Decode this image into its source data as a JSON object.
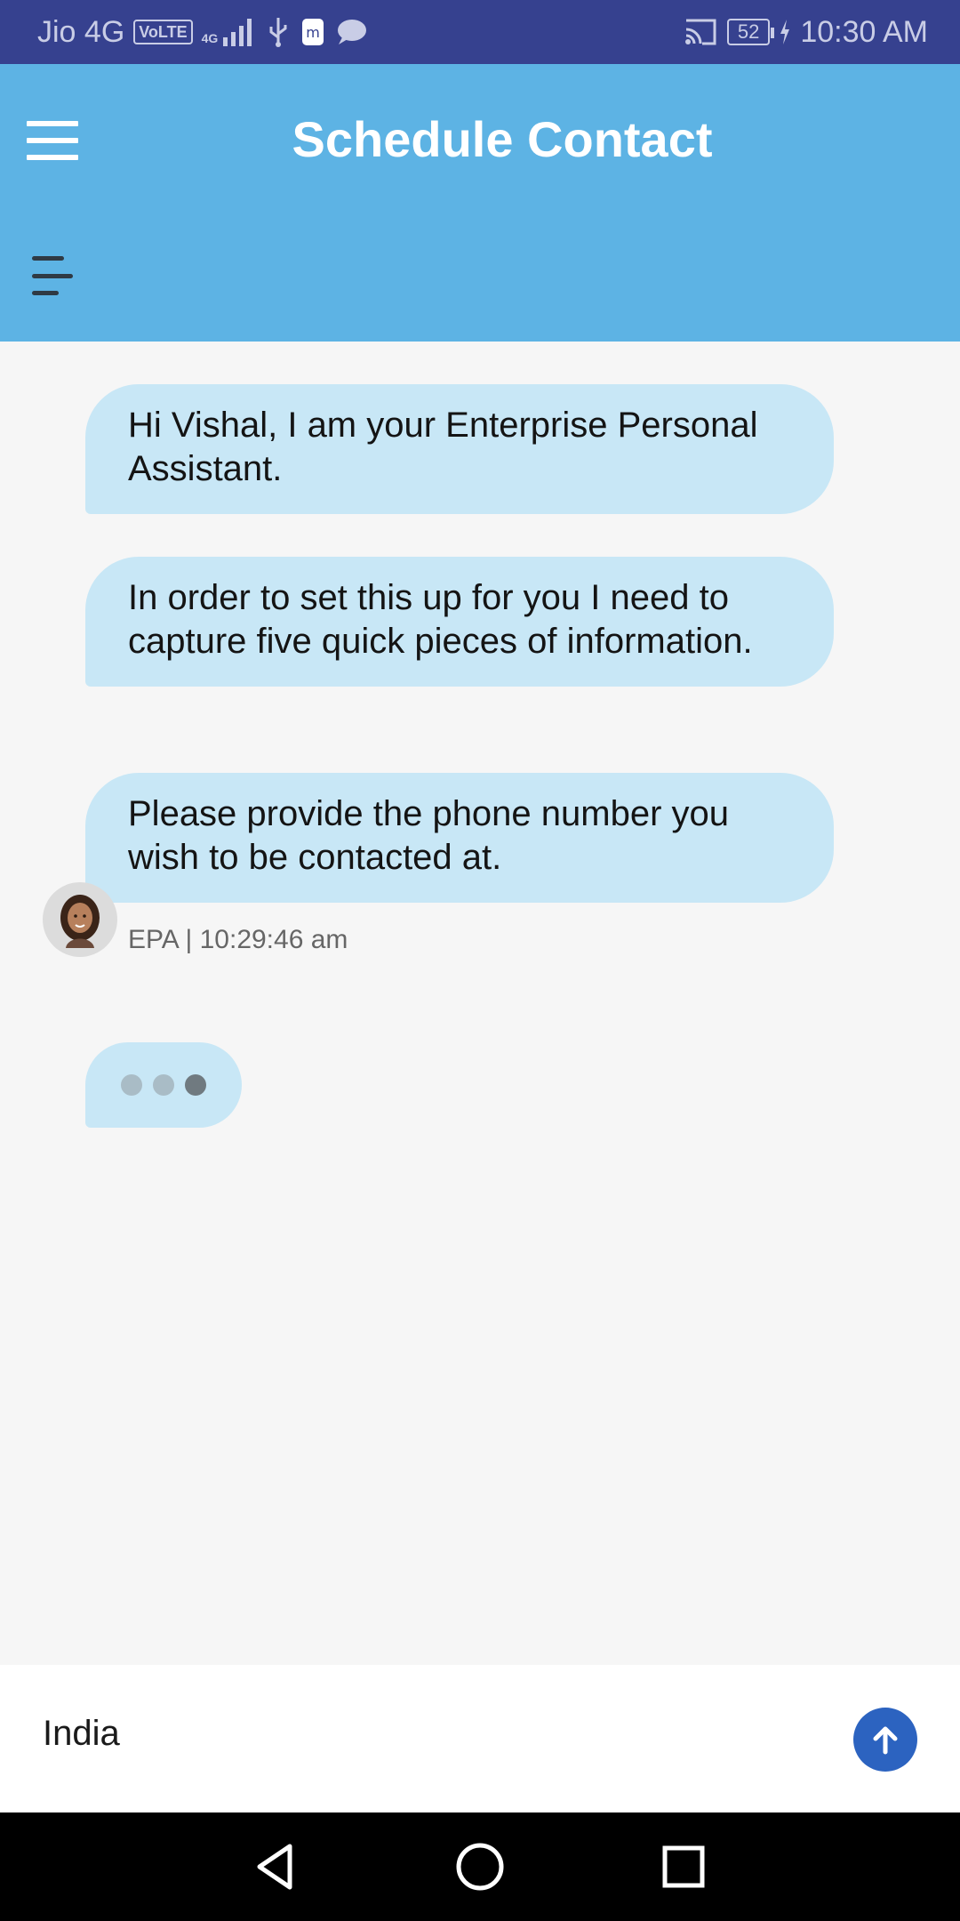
{
  "status_bar": {
    "carrier": "Jio 4G",
    "volte": "VoLTE",
    "network": "4G",
    "battery": "52",
    "time": "10:30 AM"
  },
  "header": {
    "title": "Schedule Contact",
    "menu_icon": "hamburger-menu-icon",
    "sort_icon": "sort-lines-icon",
    "background_color": "#5db3e4"
  },
  "chat": {
    "messages": [
      {
        "text": "Hi Vishal, I am your Enterprise Personal Assistant."
      },
      {
        "text": "In order to set this up for you I need to capture five quick pieces of information."
      },
      {
        "text": "Please provide the phone number you wish to be contacted at."
      }
    ],
    "sender_meta": "EPA | 10:29:46 am",
    "bubble_color": "#c8e7f6"
  },
  "composer": {
    "value": "India",
    "send_icon": "arrow-up-icon",
    "send_color": "#2c63c0"
  },
  "nav_bar": {
    "back_icon": "back-triangle-icon",
    "home_icon": "home-circle-icon",
    "recents_icon": "recents-square-icon"
  }
}
